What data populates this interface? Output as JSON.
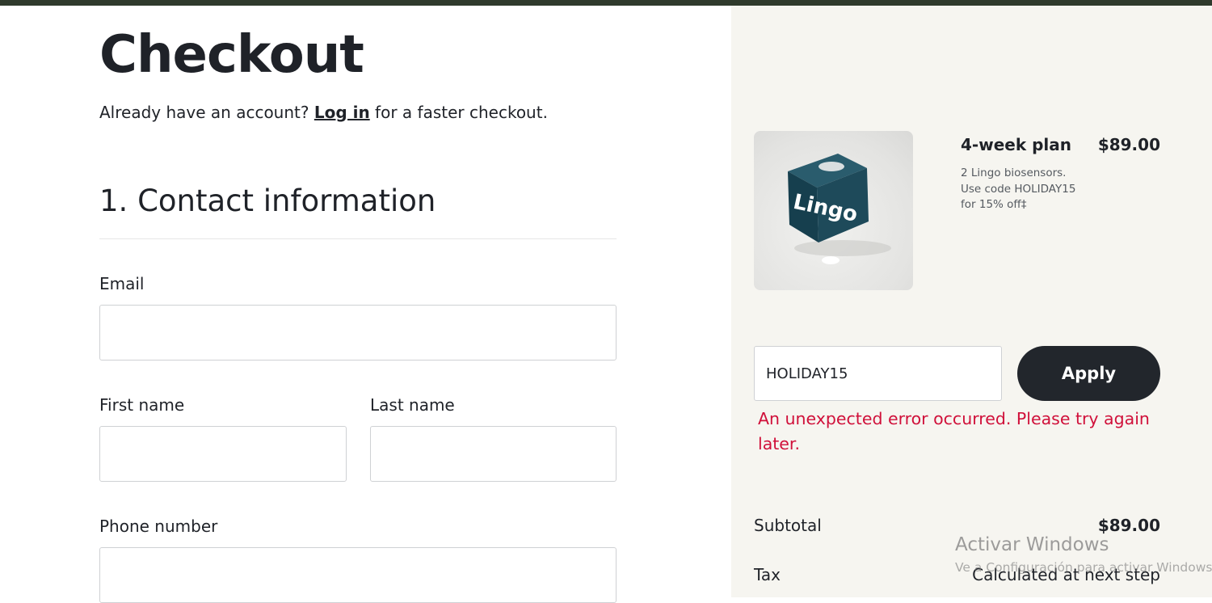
{
  "page": {
    "title": "Checkout",
    "account_prompt_before": "Already have an account? ",
    "login_link": "Log in",
    "account_prompt_after": " for a faster checkout."
  },
  "contact": {
    "section_title": "1. Contact information",
    "email_label": "Email",
    "email_value": "",
    "first_name_label": "First name",
    "first_name_value": "",
    "last_name_label": "Last name",
    "last_name_value": "",
    "phone_label": "Phone number",
    "phone_value": ""
  },
  "order": {
    "product": {
      "name": "4-week plan",
      "price": "$89.00",
      "description": "2 Lingo biosensors. Use code HOLIDAY15 for 15% off‡",
      "image_brand_text": "Lingo"
    },
    "coupon": {
      "value": "HOLIDAY15",
      "apply_label": "Apply",
      "error": "An unexpected error occurred. Please try again later."
    },
    "summary": {
      "subtotal_label": "Subtotal",
      "subtotal_value": "$89.00",
      "tax_label": "Tax",
      "tax_value": "Calculated at next step"
    }
  },
  "watermark": {
    "title": "Activar Windows",
    "subtitle": "Ve a Configuración para activar Windows."
  },
  "colors": {
    "top_strip": "#2f3a2c",
    "sidebar_bg": "#f6f5f0",
    "button_bg": "#22262c",
    "error": "#d0103a",
    "box_teal": "#1e4a5a"
  }
}
